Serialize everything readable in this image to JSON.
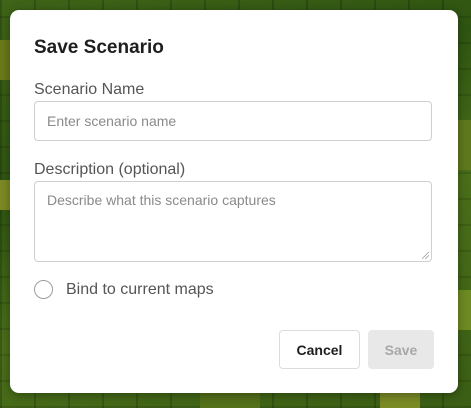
{
  "dialog": {
    "title": "Save Scenario",
    "name_label": "Scenario Name",
    "name_value": "",
    "name_placeholder": "Enter scenario name",
    "description_label": "Description (optional)",
    "description_value": "",
    "description_placeholder": "Describe what this scenario captures",
    "bind_checkbox_label": "Bind to current maps",
    "bind_checked": false,
    "cancel_label": "Cancel",
    "save_label": "Save",
    "save_enabled": false
  },
  "colors": {
    "backdrop_map": "#3f6418",
    "dialog_background": "#ffffff",
    "disabled_button": "#e8e8e8",
    "disabled_text": "#a8a8a8"
  }
}
